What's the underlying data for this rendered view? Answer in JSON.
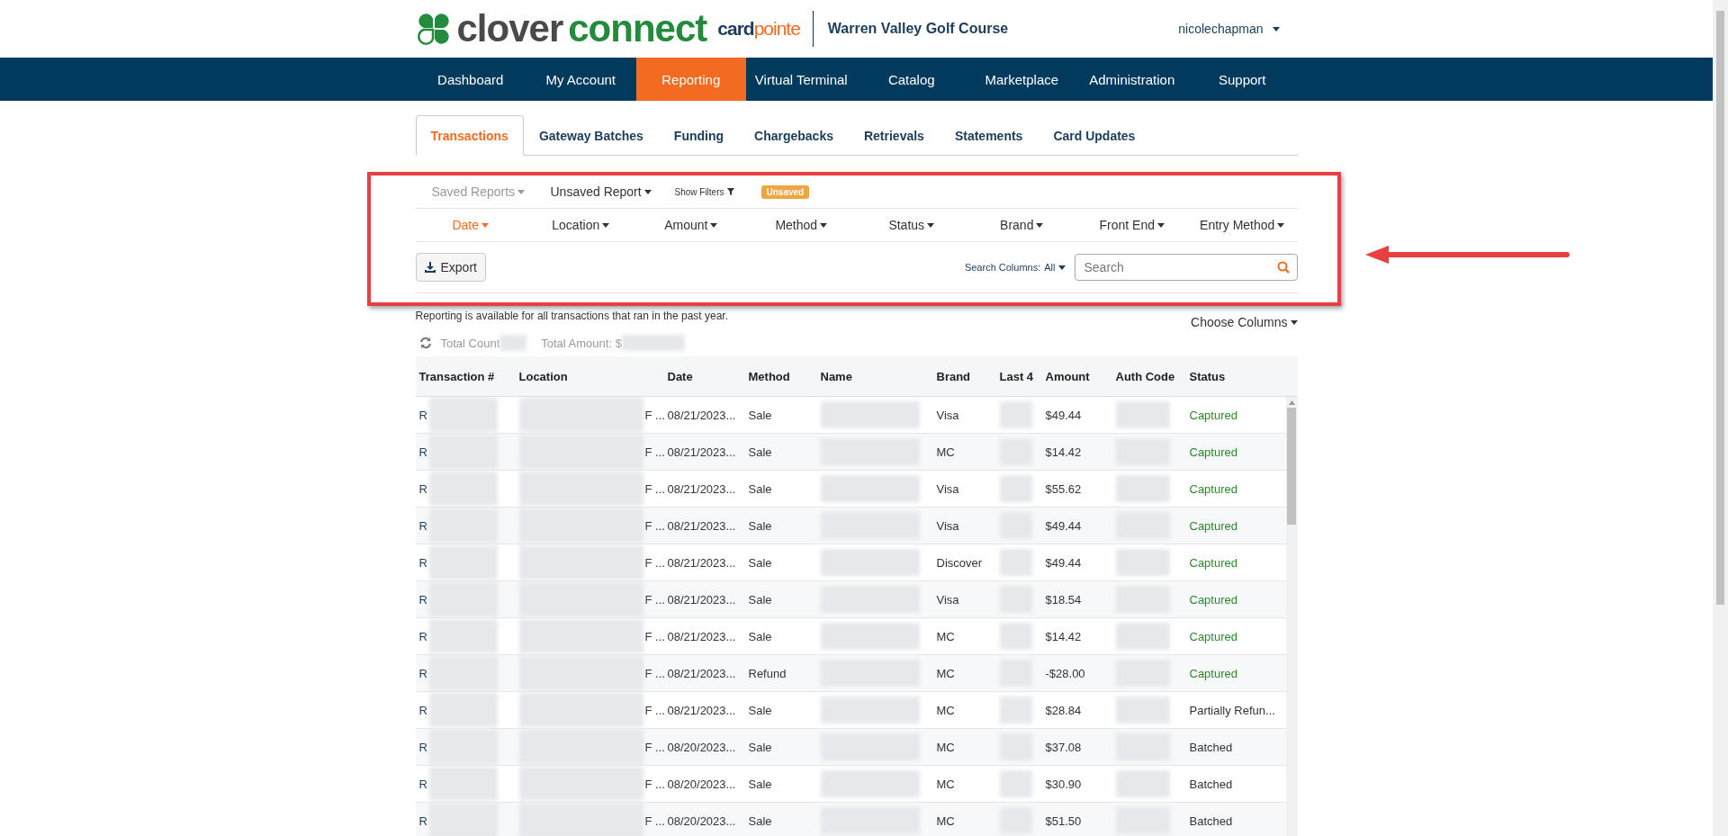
{
  "header": {
    "logo": {
      "clover": "clover",
      "connect": "connect",
      "card": "card",
      "pointe": "pointe"
    },
    "merchant": "Warren Valley Golf Course",
    "user": "nicolechapman"
  },
  "nav": [
    {
      "label": "Dashboard",
      "selected": false
    },
    {
      "label": "My Account",
      "selected": false
    },
    {
      "label": "Reporting",
      "selected": true
    },
    {
      "label": "Virtual Terminal",
      "selected": false
    },
    {
      "label": "Catalog",
      "selected": false
    },
    {
      "label": "Marketplace",
      "selected": false
    },
    {
      "label": "Administration",
      "selected": false
    },
    {
      "label": "Support",
      "selected": false
    }
  ],
  "tabs": [
    {
      "label": "Transactions",
      "selected": true
    },
    {
      "label": "Gateway Batches",
      "selected": false
    },
    {
      "label": "Funding",
      "selected": false
    },
    {
      "label": "Chargebacks",
      "selected": false
    },
    {
      "label": "Retrievals",
      "selected": false
    },
    {
      "label": "Statements",
      "selected": false
    },
    {
      "label": "Card Updates",
      "selected": false
    }
  ],
  "report_bar": {
    "saved_reports": "Saved Reports",
    "report_name": "Unsaved Report",
    "show_filters": "Show Filters",
    "badge": "Unsaved"
  },
  "column_filters": [
    {
      "label": "Date",
      "selected": true
    },
    {
      "label": "Location",
      "selected": false
    },
    {
      "label": "Amount",
      "selected": false
    },
    {
      "label": "Method",
      "selected": false
    },
    {
      "label": "Status",
      "selected": false
    },
    {
      "label": "Brand",
      "selected": false
    },
    {
      "label": "Front End",
      "selected": false
    },
    {
      "label": "Entry Method",
      "selected": false
    }
  ],
  "toolbar": {
    "export": "Export",
    "search_columns_label": "Search Columns:",
    "search_columns_value": "All",
    "search_placeholder": "Search"
  },
  "notice": "Reporting is available for all transactions that ran in the past year.",
  "choose_columns": "Choose Columns",
  "totals": {
    "count_label": "Total Count",
    "amount_label": "Total Amount: $"
  },
  "table": {
    "columns": [
      "Transaction #",
      "Location",
      "Date",
      "Method",
      "Name",
      "Brand",
      "Last 4",
      "Amount",
      "Auth Code",
      "Status"
    ],
    "rows": [
      {
        "transaction": "R",
        "location": "F ...",
        "date": "08/21/2023...",
        "method": "Sale",
        "brand": "Visa",
        "amount": "$49.44",
        "status": {
          "text": "Captured",
          "color": "#2a8a2a"
        }
      },
      {
        "transaction": "R",
        "location": "F ...",
        "date": "08/21/2023...",
        "method": "Sale",
        "brand": "MC",
        "amount": "$14.42",
        "status": {
          "text": "Captured",
          "color": "#2a8a2a"
        }
      },
      {
        "transaction": "R",
        "location": "F ...",
        "date": "08/21/2023...",
        "method": "Sale",
        "brand": "Visa",
        "amount": "$55.62",
        "status": {
          "text": "Captured",
          "color": "#2a8a2a"
        }
      },
      {
        "transaction": "R",
        "location": "F ...",
        "date": "08/21/2023...",
        "method": "Sale",
        "brand": "Visa",
        "amount": "$49.44",
        "status": {
          "text": "Captured",
          "color": "#2a8a2a"
        }
      },
      {
        "transaction": "R",
        "location": "F ...",
        "date": "08/21/2023...",
        "method": "Sale",
        "brand": "Discover",
        "amount": "$49.44",
        "status": {
          "text": "Captured",
          "color": "#2a8a2a"
        }
      },
      {
        "transaction": "R",
        "location": "F ...",
        "date": "08/21/2023...",
        "method": "Sale",
        "brand": "Visa",
        "amount": "$18.54",
        "status": {
          "text": "Captured",
          "color": "#2a8a2a"
        }
      },
      {
        "transaction": "R",
        "location": "F ...",
        "date": "08/21/2023...",
        "method": "Sale",
        "brand": "MC",
        "amount": "$14.42",
        "status": {
          "text": "Captured",
          "color": "#2a8a2a"
        }
      },
      {
        "transaction": "R",
        "location": "F ...",
        "date": "08/21/2023...",
        "method": "Refund",
        "brand": "MC",
        "amount": "-$28.00",
        "status": {
          "text": "Captured",
          "color": "#2a8a2a"
        }
      },
      {
        "transaction": "R",
        "location": "F ...",
        "date": "08/21/2023...",
        "method": "Sale",
        "brand": "MC",
        "amount": "$28.84",
        "status": {
          "text": "Partially Refun...",
          "color": "#333333"
        }
      },
      {
        "transaction": "R",
        "location": "F ...",
        "date": "08/20/2023...",
        "method": "Sale",
        "brand": "MC",
        "amount": "$37.08",
        "status": {
          "text": "Batched",
          "color": "#333333"
        }
      },
      {
        "transaction": "R",
        "location": "F ...",
        "date": "08/20/2023...",
        "method": "Sale",
        "brand": "MC",
        "amount": "$30.90",
        "status": {
          "text": "Batched",
          "color": "#333333"
        }
      },
      {
        "transaction": "R",
        "location": "F ...",
        "date": "08/20/2023...",
        "method": "Sale",
        "brand": "MC",
        "amount": "$51.50",
        "status": {
          "text": "Batched",
          "color": "#333333"
        }
      }
    ]
  }
}
